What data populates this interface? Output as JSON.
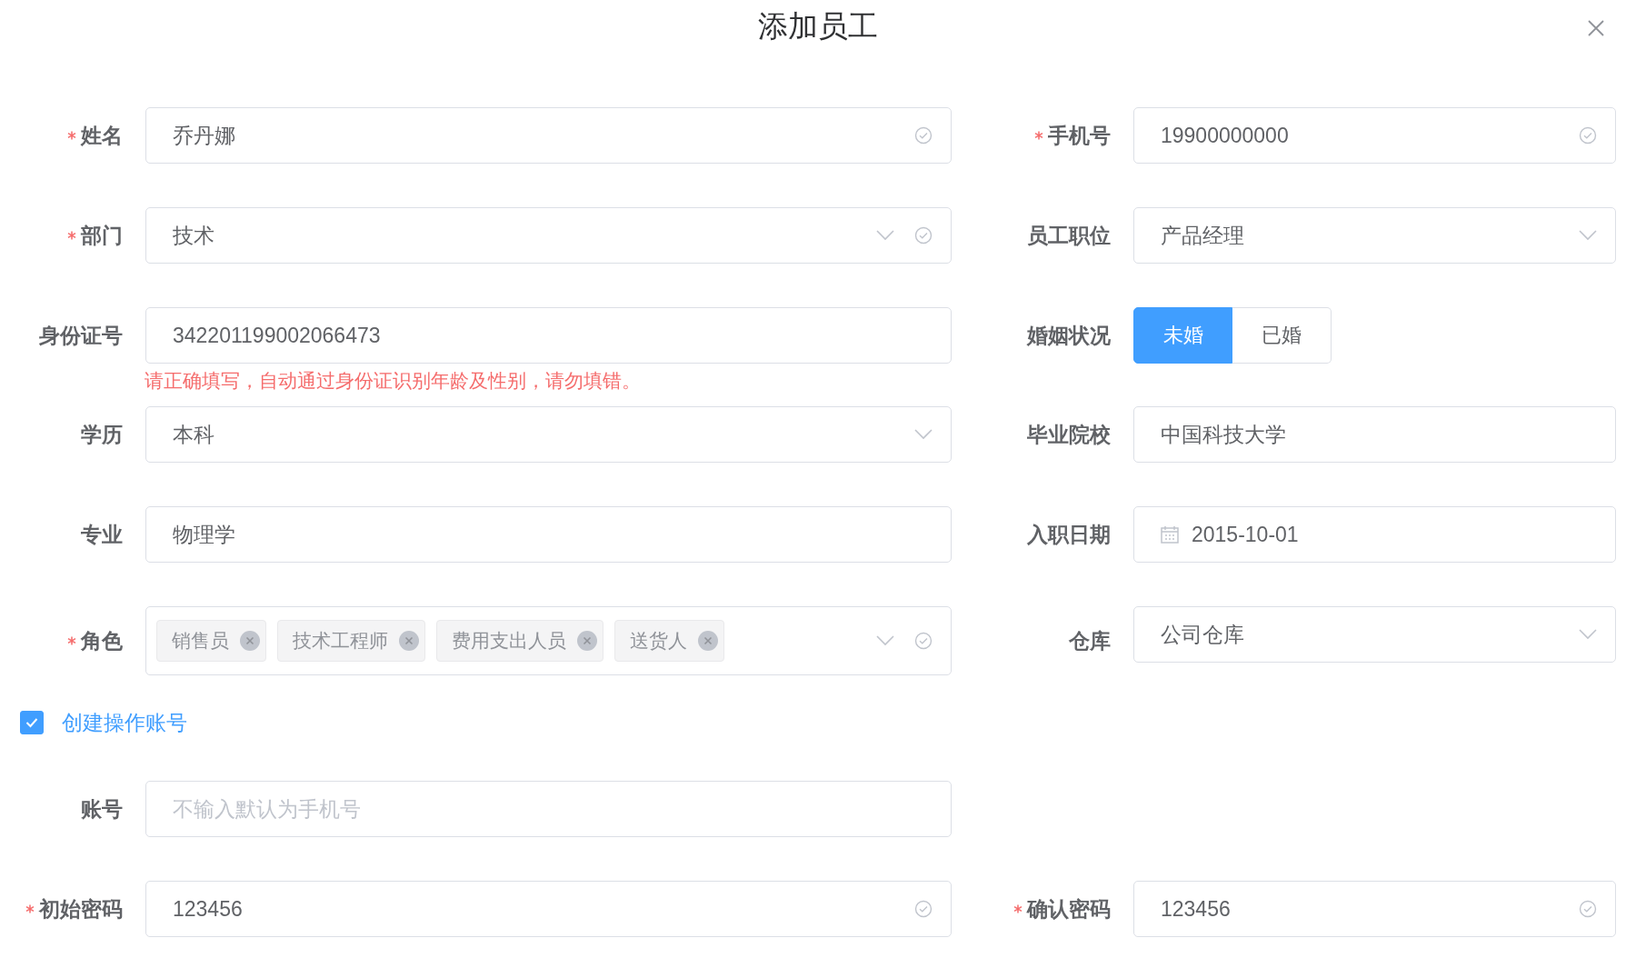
{
  "dialog": {
    "title": "添加员工"
  },
  "rows": [
    {
      "fields": [
        {
          "kind": "text",
          "label": "姓名",
          "required": true,
          "value": "乔丹娜",
          "valid": true
        },
        {
          "kind": "text",
          "label": "手机号",
          "required": true,
          "value": "19900000000",
          "valid": true
        }
      ]
    },
    {
      "fields": [
        {
          "kind": "select",
          "label": "部门",
          "required": true,
          "value": "技术",
          "valid": true
        },
        {
          "kind": "select",
          "label": "员工职位",
          "required": false,
          "value": "产品经理",
          "valid": false
        }
      ]
    },
    {
      "fields": [
        {
          "kind": "text",
          "label": "身份证号",
          "required": false,
          "value": "342201199002066473",
          "valid": false,
          "hint": "请正确填写，自动通过身份证识别年龄及性别，请勿填错。"
        },
        {
          "kind": "segmented",
          "label": "婚姻状况",
          "required": false,
          "options": [
            {
              "label": "未婚",
              "selected": true
            },
            {
              "label": "已婚",
              "selected": false
            }
          ]
        }
      ]
    },
    {
      "fields": [
        {
          "kind": "select",
          "label": "学历",
          "required": false,
          "value": "本科",
          "valid": false
        },
        {
          "kind": "text",
          "label": "毕业院校",
          "required": false,
          "value": "中国科技大学",
          "valid": false
        }
      ]
    },
    {
      "fields": [
        {
          "kind": "text",
          "label": "专业",
          "required": false,
          "value": "物理学",
          "valid": false
        },
        {
          "kind": "date",
          "label": "入职日期",
          "required": false,
          "value": "2015-10-01",
          "valid": false
        }
      ]
    },
    {
      "fields": [
        {
          "kind": "tags",
          "label": "角色",
          "required": true,
          "tags": [
            "销售员",
            "技术工程师",
            "费用支出人员",
            "送货人"
          ],
          "valid": true
        },
        {
          "kind": "select",
          "label": "仓库",
          "required": false,
          "value": "公司仓库",
          "valid": false
        }
      ]
    },
    {
      "fields": [
        {
          "kind": "checkbox",
          "label": "创建操作账号",
          "checked": true
        }
      ]
    },
    {
      "fields": [
        {
          "kind": "text",
          "label": "账号",
          "required": false,
          "placeholder": "不输入默认为手机号",
          "valid": false
        }
      ]
    },
    {
      "fields": [
        {
          "kind": "text",
          "label": "初始密码",
          "required": true,
          "value": "123456",
          "valid": true
        },
        {
          "kind": "text",
          "label": "确认密码",
          "required": true,
          "value": "123456",
          "valid": true
        }
      ]
    }
  ]
}
